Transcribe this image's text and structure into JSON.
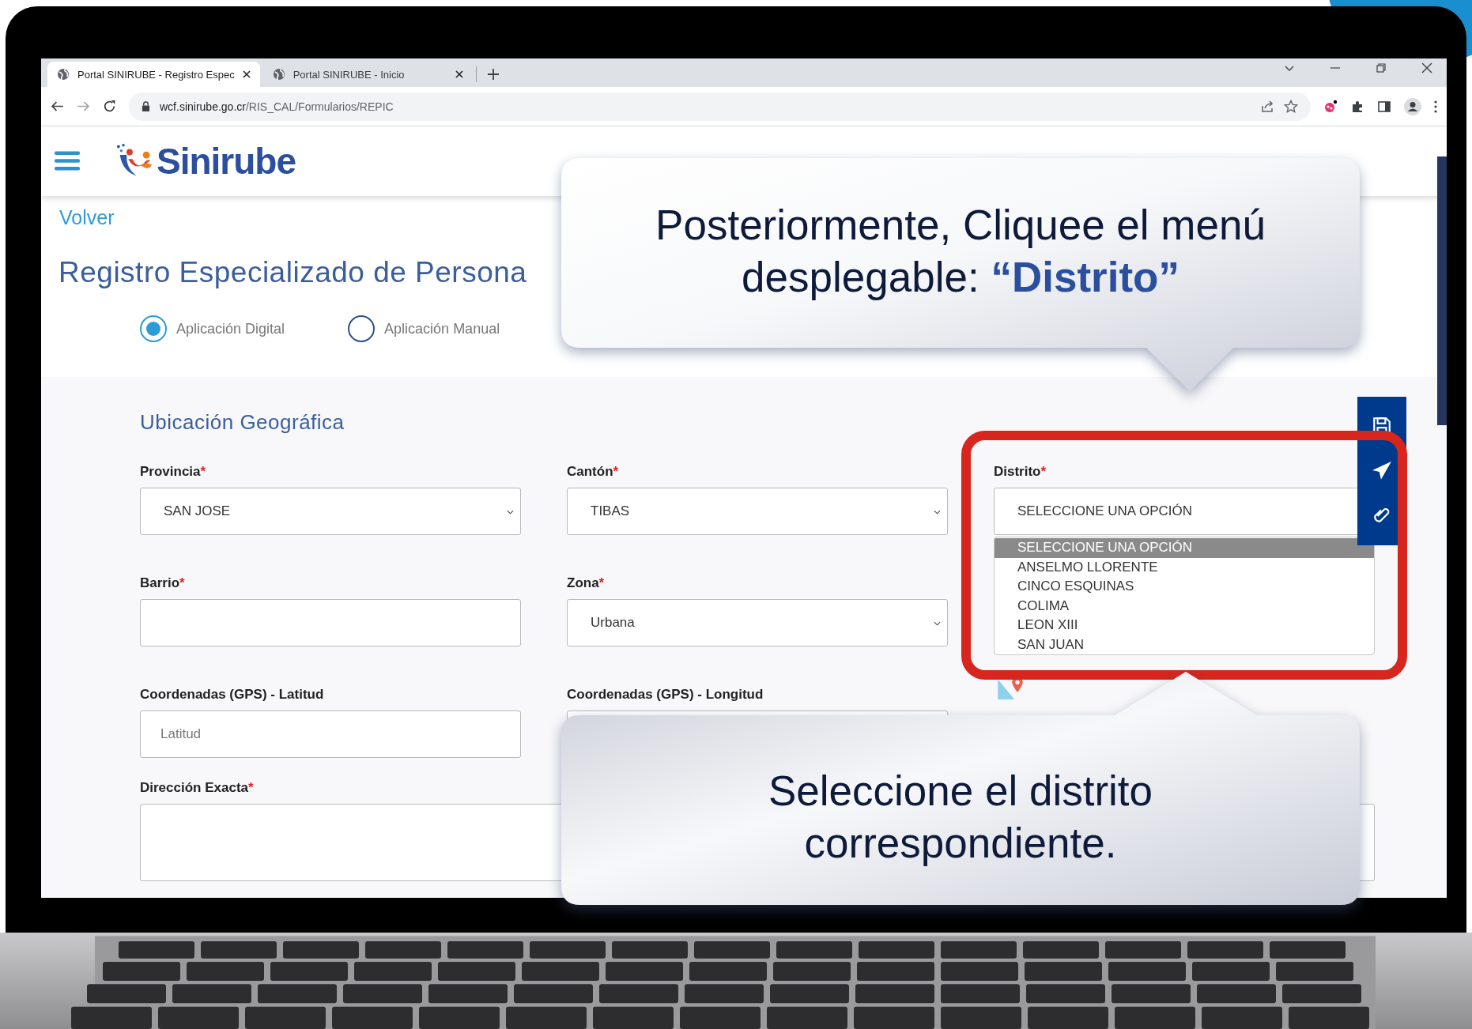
{
  "browser": {
    "tabs": [
      {
        "title": "Portal SINIRUBE - Registro Espec",
        "selected": true
      },
      {
        "title": "Portal SINIRUBE - Inicio",
        "selected": false
      }
    ],
    "url_host": "wcf.sinirube.go.cr",
    "url_path": "/RIS_CAL/Formularios/REPIC"
  },
  "header": {
    "logo_text": "Sinirube"
  },
  "back_link": "Volver",
  "page_title": "Registro Especializado de Persona",
  "application_type": [
    {
      "label": "Aplicación Digital",
      "selected": true
    },
    {
      "label": "Aplicación Manual",
      "selected": false
    }
  ],
  "required_mark": "*",
  "section": {
    "title": "Ubicación Geográfica",
    "fields": [
      {
        "kind": "select",
        "label": "Provincia",
        "required": true,
        "value": "SAN JOSE"
      },
      {
        "kind": "select",
        "label": "Cantón",
        "required": true,
        "value": "TIBAS"
      },
      {
        "kind": "select_open",
        "label": "Distrito",
        "required": true,
        "value": "SELECCIONE UNA OPCIÓN",
        "options": [
          {
            "label": "SELECCIONE UNA OPCIÓN",
            "selected": true
          },
          {
            "label": "ANSELMO LLORENTE",
            "selected": false
          },
          {
            "label": "CINCO ESQUINAS",
            "selected": false
          },
          {
            "label": "COLIMA",
            "selected": false
          },
          {
            "label": "LEON XIII",
            "selected": false
          },
          {
            "label": "SAN JUAN",
            "selected": false
          }
        ]
      },
      {
        "kind": "text",
        "label": "Barrio",
        "required": true
      },
      {
        "kind": "select",
        "label": "Zona",
        "required": true,
        "value": "Urbana"
      },
      {
        "kind": "text",
        "label": "Coordenadas (GPS) - Latitud",
        "required": false,
        "placeholder": "Latitud"
      },
      {
        "kind": "text",
        "label": "Coordenadas (GPS) - Longitud",
        "required": false
      },
      {
        "kind": "map_button"
      },
      {
        "kind": "textarea",
        "label": "Dirección Exacta",
        "required": true
      }
    ]
  },
  "callouts": [
    {
      "kind": "down",
      "text": "Posteriormente, Cliquee el menú desplegable: **“Distrito”**"
    },
    {
      "kind": "up",
      "text": "Seleccione el distrito correspondiente."
    }
  ]
}
